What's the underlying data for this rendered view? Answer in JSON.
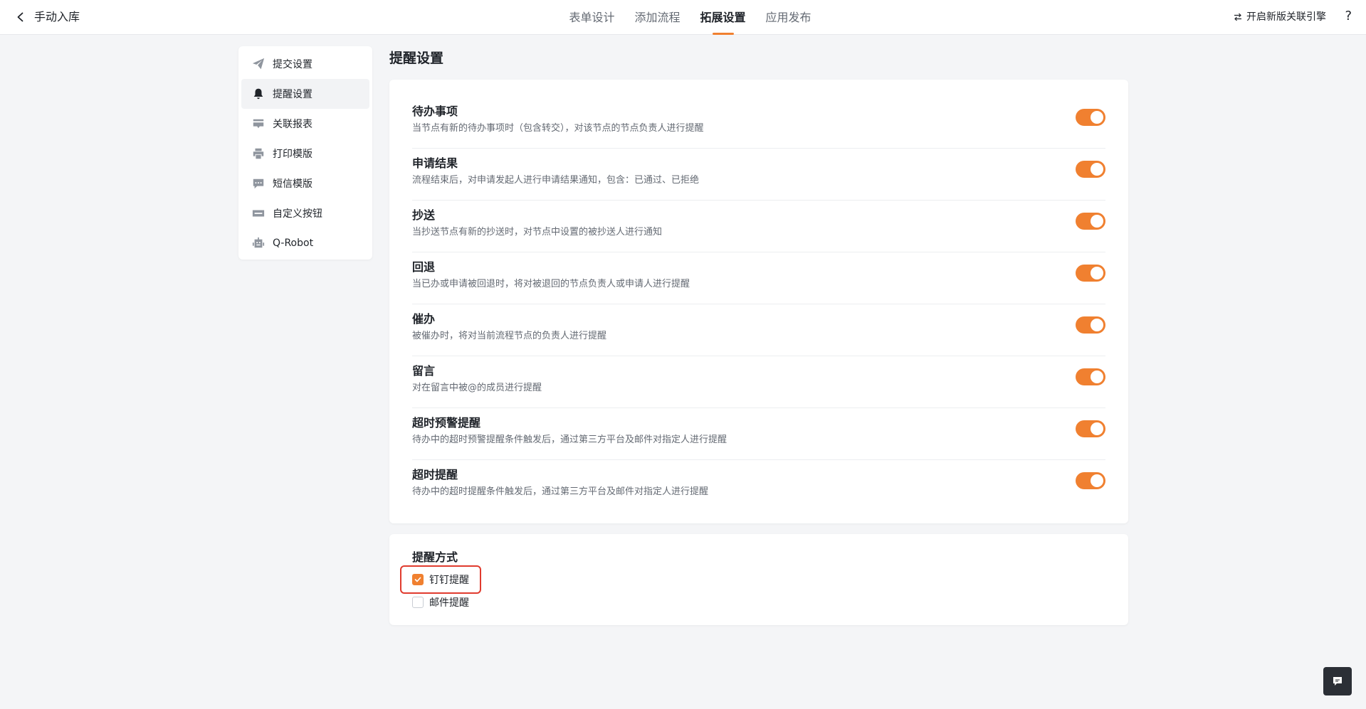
{
  "header": {
    "title": "手动入库",
    "tabs": [
      {
        "label": "表单设计",
        "active": false
      },
      {
        "label": "添加流程",
        "active": false
      },
      {
        "label": "拓展设置",
        "active": true
      },
      {
        "label": "应用发布",
        "active": false
      }
    ],
    "engine_label": "开启新版关联引擎",
    "help_label": "?"
  },
  "sidebar": {
    "items": [
      {
        "label": "提交设置",
        "icon": "paper-plane-icon",
        "active": false
      },
      {
        "label": "提醒设置",
        "icon": "bell-icon",
        "active": true
      },
      {
        "label": "关联报表",
        "icon": "report-icon",
        "active": false
      },
      {
        "label": "打印模版",
        "icon": "printer-icon",
        "active": false
      },
      {
        "label": "短信模版",
        "icon": "message-icon",
        "active": false
      },
      {
        "label": "自定义按钮",
        "icon": "button-icon",
        "active": false
      },
      {
        "label": "Q-Robot",
        "icon": "robot-icon",
        "active": false
      }
    ]
  },
  "main": {
    "title": "提醒设置",
    "rules": [
      {
        "title": "待办事项",
        "desc": "当节点有新的待办事项时（包含转交），对该节点的节点负责人进行提醒",
        "enabled": true
      },
      {
        "title": "申请结果",
        "desc": "流程结束后，对申请发起人进行申请结果通知，包含：已通过、已拒绝",
        "enabled": true
      },
      {
        "title": "抄送",
        "desc": "当抄送节点有新的抄送时，对节点中设置的被抄送人进行通知",
        "enabled": true
      },
      {
        "title": "回退",
        "desc": "当已办或申请被回退时，将对被退回的节点负责人或申请人进行提醒",
        "enabled": true
      },
      {
        "title": "催办",
        "desc": "被催办时，将对当前流程节点的负责人进行提醒",
        "enabled": true
      },
      {
        "title": "留言",
        "desc": "对在留言中被@的成员进行提醒",
        "enabled": true
      },
      {
        "title": "超时预警提醒",
        "desc": "待办中的超时预警提醒条件触发后，通过第三方平台及邮件对指定人进行提醒",
        "enabled": true
      },
      {
        "title": "超时提醒",
        "desc": "待办中的超时提醒条件触发后，通过第三方平台及邮件对指定人进行提醒",
        "enabled": true
      }
    ],
    "methods": {
      "title": "提醒方式",
      "options": [
        {
          "label": "钉钉提醒",
          "checked": true
        },
        {
          "label": "邮件提醒",
          "checked": false
        }
      ]
    }
  },
  "colors": {
    "accent": "#f08030",
    "highlight": "#e03b2e"
  }
}
